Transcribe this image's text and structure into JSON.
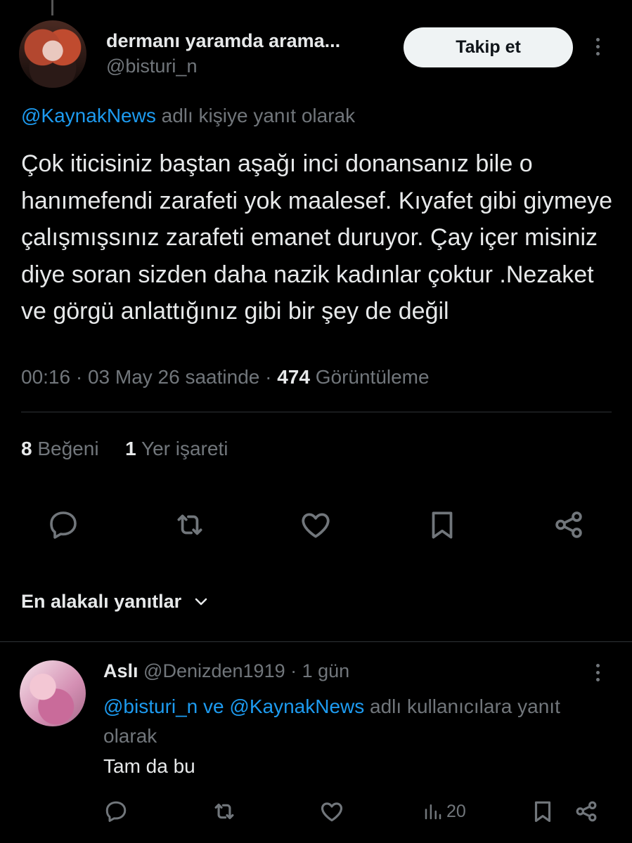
{
  "tweet": {
    "author": {
      "display_name": "dermanı yaramda arama...",
      "handle": "@bisturi_n"
    },
    "follow_label": "Takip et",
    "replying_to": {
      "mention": "@KaynakNews",
      "suffix": " adlı kişiye yanıt olarak"
    },
    "text": "Çok iticisiniz baştan aşağı inci donansanız bile o hanımefendi zarafeti yok maalesef. Kıyafet gibi giymeye çalışmışsınız zarafeti emanet duruyor. Çay içer misiniz diye soran sizden daha nazik kadınlar çoktur .Nezaket ve görgü anlattığınız gibi bir şey de değil",
    "timestamp": "00:16 · 03 May 26 saatinde · ",
    "views_count": "474",
    "views_label": " Görüntüleme",
    "likes_count": "8",
    "likes_label": "Beğeni",
    "bookmarks_count": "1",
    "bookmarks_label": "Yer işareti",
    "actions": [
      "reply-icon",
      "retweet-icon",
      "like-icon",
      "bookmark-icon",
      "share-icon"
    ]
  },
  "sort": {
    "label": "En alakalı yanıtlar",
    "icon": "chevron-down-icon"
  },
  "reply": {
    "author_name": "Aslı",
    "handle": "@Denizden1919",
    "age": "1 gün",
    "replying_mention_1": "@bisturi_n",
    "replying_ve": " ve ",
    "replying_mention_2": "@KaynakNews",
    "replying_suffix": " adlı kullanıcılara yanıt olarak",
    "text": "Tam da bu",
    "views": "20"
  },
  "colors": {
    "background": "#000000",
    "text": "#e7e9ea",
    "secondary": "#71767b",
    "link": "#1d9bf0",
    "divider": "#2f3336",
    "button_bg": "#eff3f4"
  }
}
